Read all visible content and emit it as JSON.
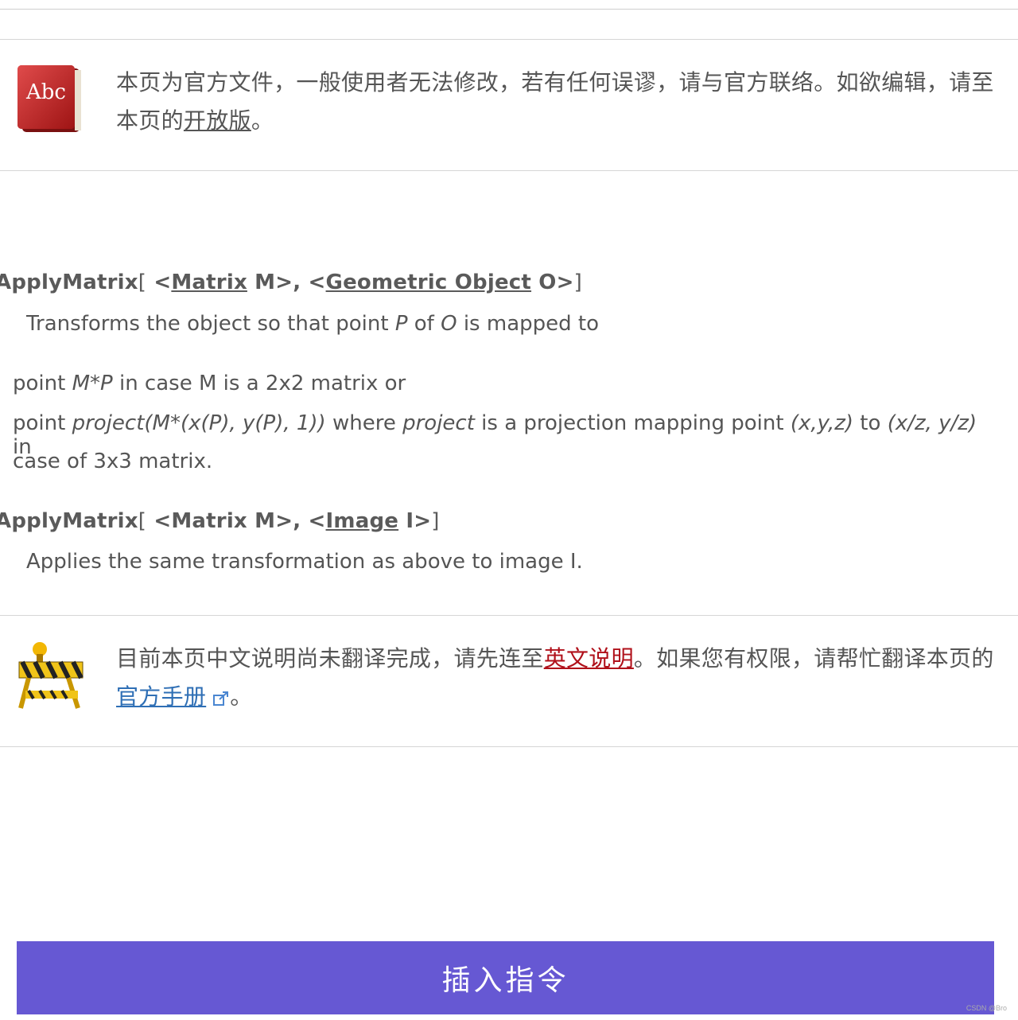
{
  "notice_official": {
    "text": "本页为官方文件，一般使用者无法修改，若有任何误谬，请与官方联络。如欲编辑，请至本页的",
    "link": "开放版",
    "suffix": "。"
  },
  "syntax1": {
    "name": "ApplyMatrix",
    "open": "[",
    "part1_prefix": " <",
    "part1_link": "Matrix",
    "part1_suffix": " M>, <",
    "part2_link": "Geometric Object",
    "part2_suffix": " O>",
    "close": "]",
    "desc_a": "Transforms the object so that point ",
    "desc_p": "P",
    "desc_b": " of ",
    "desc_o": "O",
    "desc_c": " is mapped to"
  },
  "lines": {
    "l1_a": "point ",
    "l1_b": "M*P",
    "l1_c": " in case M is a 2x2 matrix or",
    "l2_a": "point ",
    "l2_b": "project(M*(x(P), y(P), 1))",
    "l2_c": " where ",
    "l2_d": "project",
    "l2_e": " is a projection mapping point ",
    "l2_f": "(x,y,z)",
    "l2_g": " to ",
    "l2_h": "(x/z, y/z)",
    "l2_i": " in",
    "l3": "case of 3x3 matrix."
  },
  "syntax2": {
    "name": "ApplyMatrix",
    "open": "[",
    "part1": " <Matrix M>, <",
    "part2_link": "Image",
    "part2_suffix": " I>",
    "close": "]",
    "desc": "Applies the same transformation as above to image I."
  },
  "notice_translate": {
    "text_a": "目前本页中文说明尚未翻译完成，请先连至",
    "link_en": "英文说明",
    "text_b": "。如果您有权限，请帮忙翻译本页的",
    "link_manual": "官方手册",
    "suffix": "。"
  },
  "insert_button": {
    "label": "插入指令"
  },
  "watermark": "CSDN @Bro",
  "colors": {
    "button": "#6658d3",
    "link_red": "#b0101a",
    "link_blue": "#2f6fb5"
  },
  "icons": [
    "dictionary-book-icon",
    "construction-barrier-icon",
    "external-link-icon"
  ]
}
